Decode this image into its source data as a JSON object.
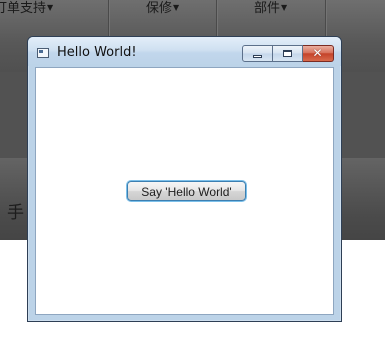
{
  "background": {
    "nav_items": [
      {
        "label": "订单支持"
      },
      {
        "label": "保修"
      },
      {
        "label": "部件"
      }
    ],
    "lower_text": "手"
  },
  "window": {
    "title": "Hello World!",
    "icons": {
      "app": "app-window-icon",
      "minimize": "minimize-icon",
      "maximize": "maximize-icon",
      "close": "close-icon"
    },
    "close_glyph": "✕",
    "button_label": "Say 'Hello World'"
  },
  "colors": {
    "close_button": "#c4432a",
    "button_focus_ring": "#7cc0ea",
    "window_frame": "#bcd3e8"
  }
}
